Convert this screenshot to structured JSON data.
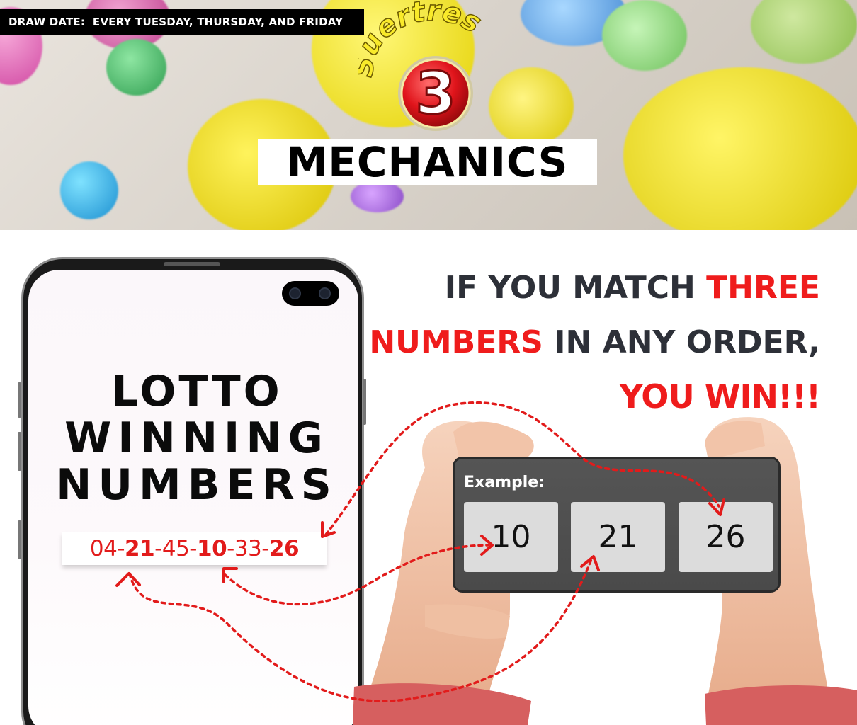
{
  "banner": {
    "draw_date": "DRAW DATE:  EVERY TUESDAY, THURSDAY, AND FRIDAY",
    "logo_text": "Suertres",
    "logo_number": "3",
    "title": "MECHANICS"
  },
  "headline": {
    "part1": "IF YOU MATCH ",
    "part2": "THREE",
    "part3": "NUMBERS",
    "part4": " IN ANY ORDER,",
    "part5": "YOU WIN!!!"
  },
  "phone": {
    "title_line1": "LOTTO",
    "title_line2": "WINNING",
    "title_line3": "NUMBERS",
    "numbers": [
      {
        "text": "04-",
        "bold": false
      },
      {
        "text": "21",
        "bold": true
      },
      {
        "text": "-45-",
        "bold": false
      },
      {
        "text": "10",
        "bold": true
      },
      {
        "text": "-33-",
        "bold": false
      },
      {
        "text": "26",
        "bold": true
      }
    ]
  },
  "example": {
    "label": "Example:",
    "numbers": [
      "10",
      "21",
      "26"
    ]
  },
  "colors": {
    "accent_red": "#ef1c1c",
    "text_dark": "#2d3038",
    "skin": "#f3c7ad",
    "sleeve": "#d65f5f"
  }
}
